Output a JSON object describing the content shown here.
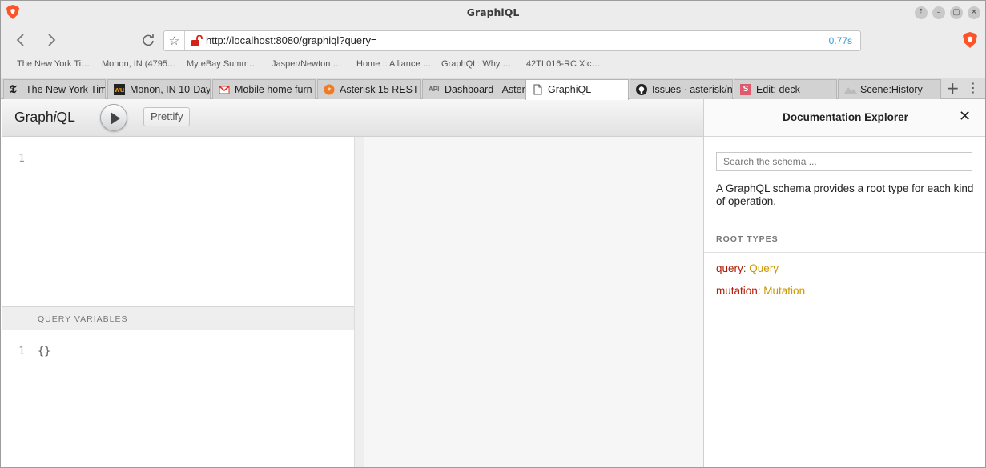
{
  "window": {
    "title": "GraphiQL"
  },
  "toolbar": {
    "url": "http://localhost:8080/graphiql?query=",
    "load_time": "0.77s"
  },
  "bookmarks": [
    "The New York Ti…",
    "Monon, IN (4795…",
    "My eBay Summ…",
    "Jasper/Newton …",
    "Home :: Alliance …",
    "GraphQL: Why …",
    "42TL016-RC Xic…"
  ],
  "tabs": [
    {
      "label": "The New York Tim",
      "icon": "nyt-icon"
    },
    {
      "label": "Monon, IN 10-Day",
      "icon": "wu-icon"
    },
    {
      "label": "Mobile home furn",
      "icon": "gmail-icon"
    },
    {
      "label": "Asterisk 15 REST",
      "icon": "asterisk-icon"
    },
    {
      "label": "Dashboard - Aster",
      "icon": "api-icon"
    },
    {
      "label": "GraphiQL",
      "icon": "page-icon",
      "active": true
    },
    {
      "label": "Issues · asterisk/n",
      "icon": "github-icon"
    },
    {
      "label": "Edit: deck",
      "icon": "s-icon"
    },
    {
      "label": "Scene:History",
      "icon": "scene-icon"
    }
  ],
  "graphiql": {
    "logo_pre": "Graph",
    "logo_i": "i",
    "logo_post": "QL",
    "prettify": "Prettify",
    "query_line": "1",
    "variables_title": "QUERY VARIABLES",
    "variables_line": "1",
    "variables_value": "{}"
  },
  "docs": {
    "title": "Documentation Explorer",
    "close": "✕",
    "search_placeholder": "Search the schema ...",
    "description": "A GraphQL schema provides a root type for each kind of operation.",
    "category": "ROOT TYPES",
    "root_types": [
      {
        "name": "query",
        "type": "Query"
      },
      {
        "name": "mutation",
        "type": "Mutation"
      }
    ]
  },
  "colors": {
    "keyword": "#b11a04",
    "type": "#ca9800",
    "load_time": "#3a9ad9"
  }
}
